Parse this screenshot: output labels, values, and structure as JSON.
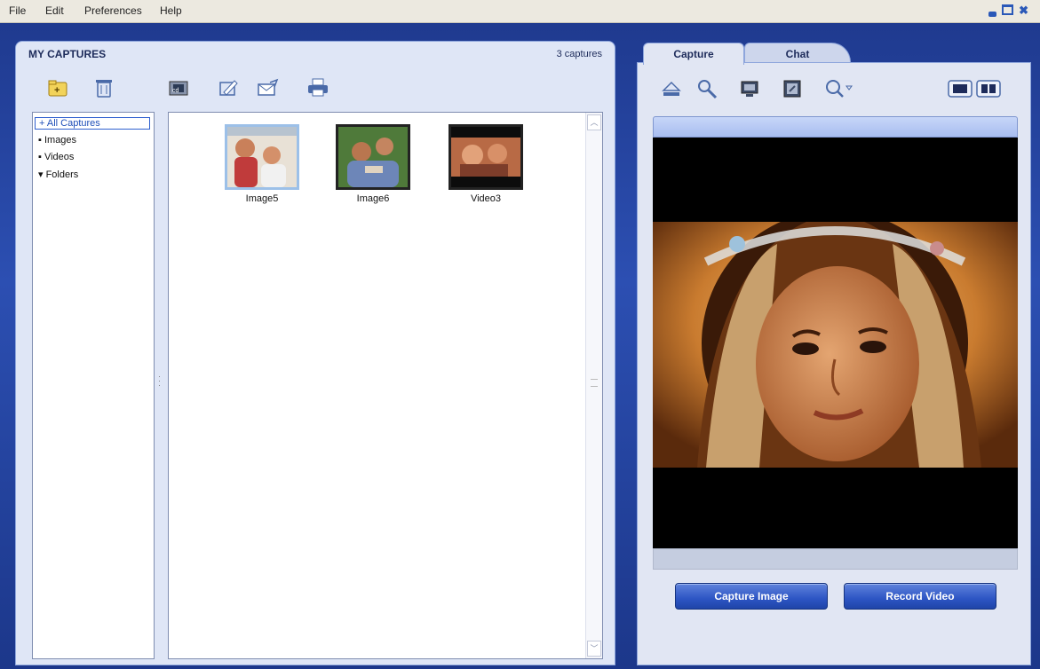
{
  "menu": {
    "items": [
      "File",
      "Edit",
      "Preferences",
      "Help"
    ]
  },
  "captures": {
    "title": "MY CAPTURES",
    "count_label": "3 captures",
    "tree": [
      "All Captures",
      "Images",
      "Videos",
      "Folders"
    ],
    "tree_selected": "All Captures",
    "items": [
      {
        "label": "Image5",
        "kind": "image",
        "selected": true
      },
      {
        "label": "Image6",
        "kind": "image",
        "selected": false
      },
      {
        "label": "Video3",
        "kind": "video",
        "selected": false
      }
    ],
    "toolbar_icons": [
      "new-folder-icon",
      "trash-icon",
      "filmstrip-icon",
      "edit-icon",
      "email-icon",
      "print-icon"
    ]
  },
  "right": {
    "tabs": [
      "Capture",
      "Chat"
    ],
    "active_tab": "Capture",
    "toolbar_icons": [
      "eject-icon",
      "settings-wrench-icon",
      "screen-icon",
      "snapshot-icon",
      "zoom-icon",
      "single-view-icon",
      "split-view-icon"
    ],
    "buttons": {
      "capture_image": "Capture Image",
      "record_video": "Record Video"
    }
  },
  "colors": {
    "frame_blue": "#2c4fb2",
    "panel_bg": "#dfe6f6",
    "button_blue": "#2d55c4"
  }
}
